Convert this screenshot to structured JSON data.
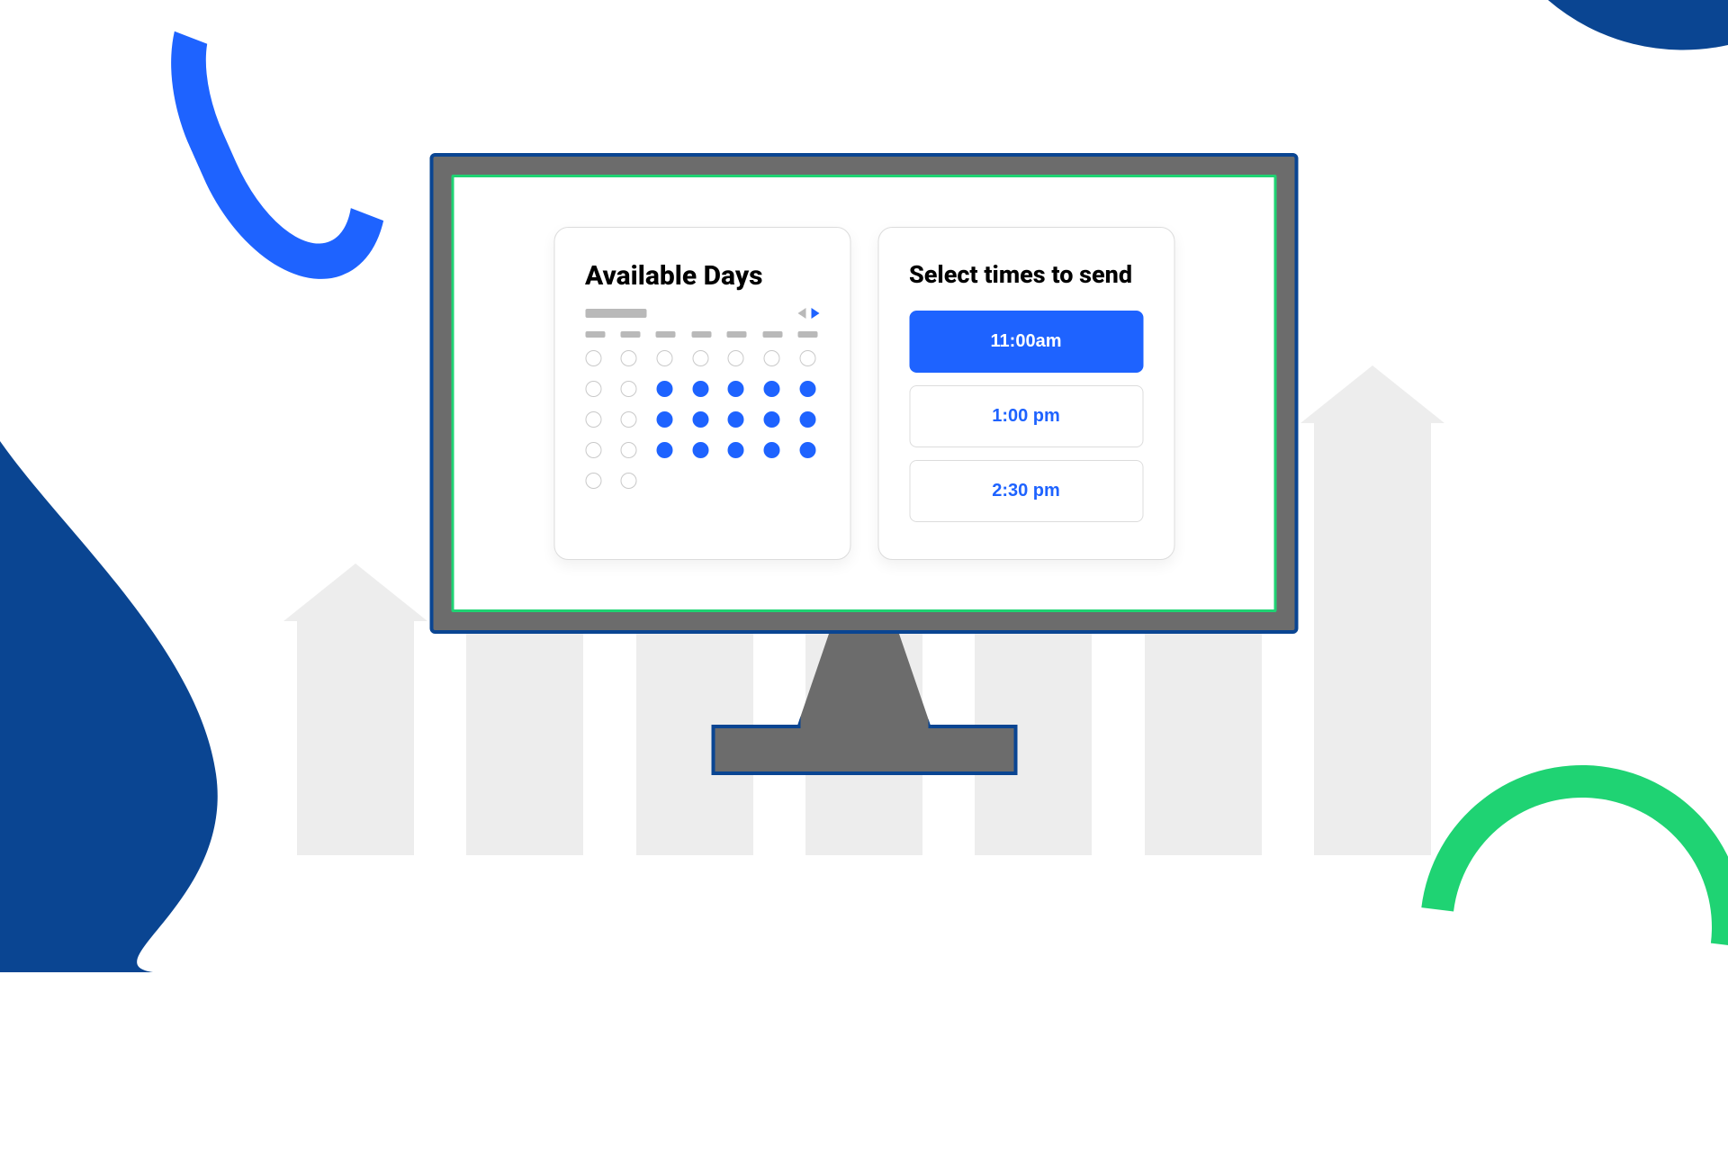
{
  "colors": {
    "blue": "#1e63ff",
    "navy": "#0a4592",
    "green": "#1fd373"
  },
  "calendar": {
    "title": "Available Days",
    "days": [
      [
        0,
        0,
        0,
        0,
        0,
        0,
        0
      ],
      [
        0,
        0,
        1,
        1,
        1,
        1,
        1
      ],
      [
        0,
        0,
        1,
        1,
        1,
        1,
        1
      ],
      [
        0,
        0,
        1,
        1,
        1,
        1,
        1
      ],
      [
        0,
        0,
        null,
        null,
        null,
        null,
        null
      ]
    ]
  },
  "times": {
    "title": "Select times to send",
    "options": [
      {
        "label": "11:00am",
        "selected": true
      },
      {
        "label": "1:00 pm",
        "selected": false
      },
      {
        "label": "2:30 pm",
        "selected": false
      }
    ]
  }
}
